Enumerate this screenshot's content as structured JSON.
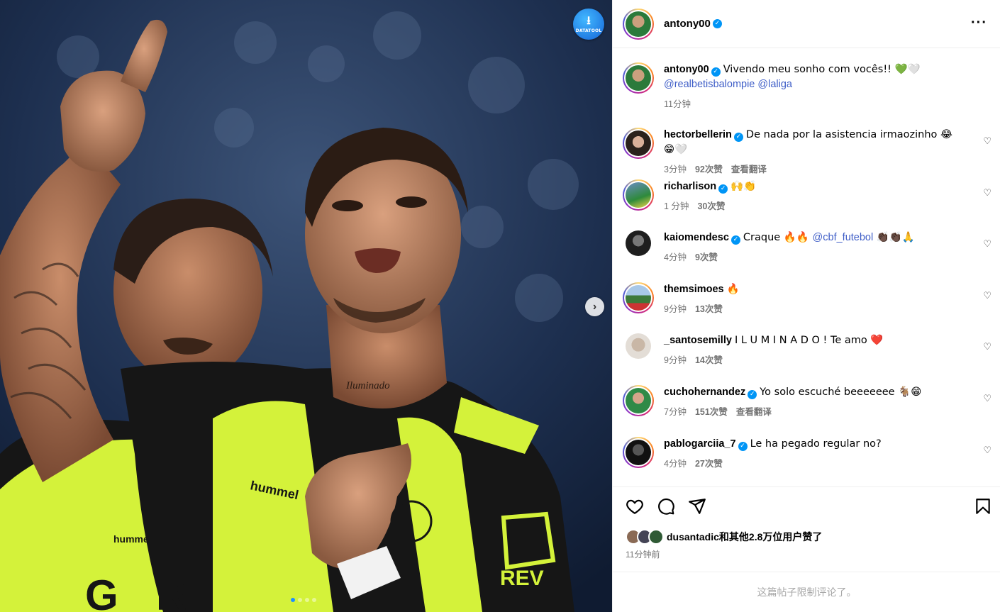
{
  "post": {
    "author": "antony00",
    "caption_text": "Vivendo meu sonho com vocês!! 💚🤍",
    "caption_mentions": [
      "@realbetisbalompie",
      "@laliga"
    ],
    "time": "11分钟",
    "more_icon": "more-horizontal-icon"
  },
  "media": {
    "download_badge_label": "DATATOOL",
    "next_icon": "chevron-right-icon",
    "jersey_text": "hummel",
    "neck_tattoo": "Iluminado",
    "carousel_count": 4,
    "carousel_active": 0
  },
  "comments": [
    {
      "user": "hectorbellerin",
      "verified": true,
      "text": "De nada por la asistencia irmaozinho 😂😁🤍",
      "time": "3分钟",
      "likes": "92次赞",
      "translate": "查看翻译"
    },
    {
      "user": "richarlison",
      "verified": true,
      "text": "🙌👏",
      "time": "1 分钟",
      "likes": "30次赞",
      "translate": ""
    },
    {
      "user": "kaiomendesc",
      "verified": true,
      "text": "Craque 🔥🔥 ",
      "mention": "@cbf_futebol",
      "text2": " 👏🏿👏🏿🙏",
      "time": "4分钟",
      "likes": "9次赞",
      "translate": ""
    },
    {
      "user": "themsimoes",
      "verified": false,
      "text": "🔥",
      "time": "9分钟",
      "likes": "13次赞",
      "translate": ""
    },
    {
      "user": "_santosemilly",
      "verified": false,
      "text": "I L U M I N A D O ! Te amo ❤️",
      "time": "9分钟",
      "likes": "14次赞",
      "translate": ""
    },
    {
      "user": "cuchohernandez",
      "verified": true,
      "text": "Yo solo escuché beeeeeee 🐐😁",
      "time": "7分钟",
      "likes": "151次赞",
      "translate": "查看翻译"
    },
    {
      "user": "pablogarciia_7",
      "verified": true,
      "text": "Le ha pegado regular no?",
      "time": "4分钟",
      "likes": "27次赞",
      "translate": ""
    }
  ],
  "actions": {
    "like_icon": "heart-icon",
    "comment_icon": "comment-icon",
    "share_icon": "send-icon",
    "save_icon": "bookmark-icon",
    "likes_text": "dusantadic和其他2.8万位用户赞了",
    "time_ago": "11分钟前",
    "comments_limited": "这篇帖子限制评论了。"
  },
  "colors": {
    "link": "#3f5ec7",
    "verified": "#0095f6",
    "muted": "#737373",
    "jersey": "#d4f23a"
  }
}
